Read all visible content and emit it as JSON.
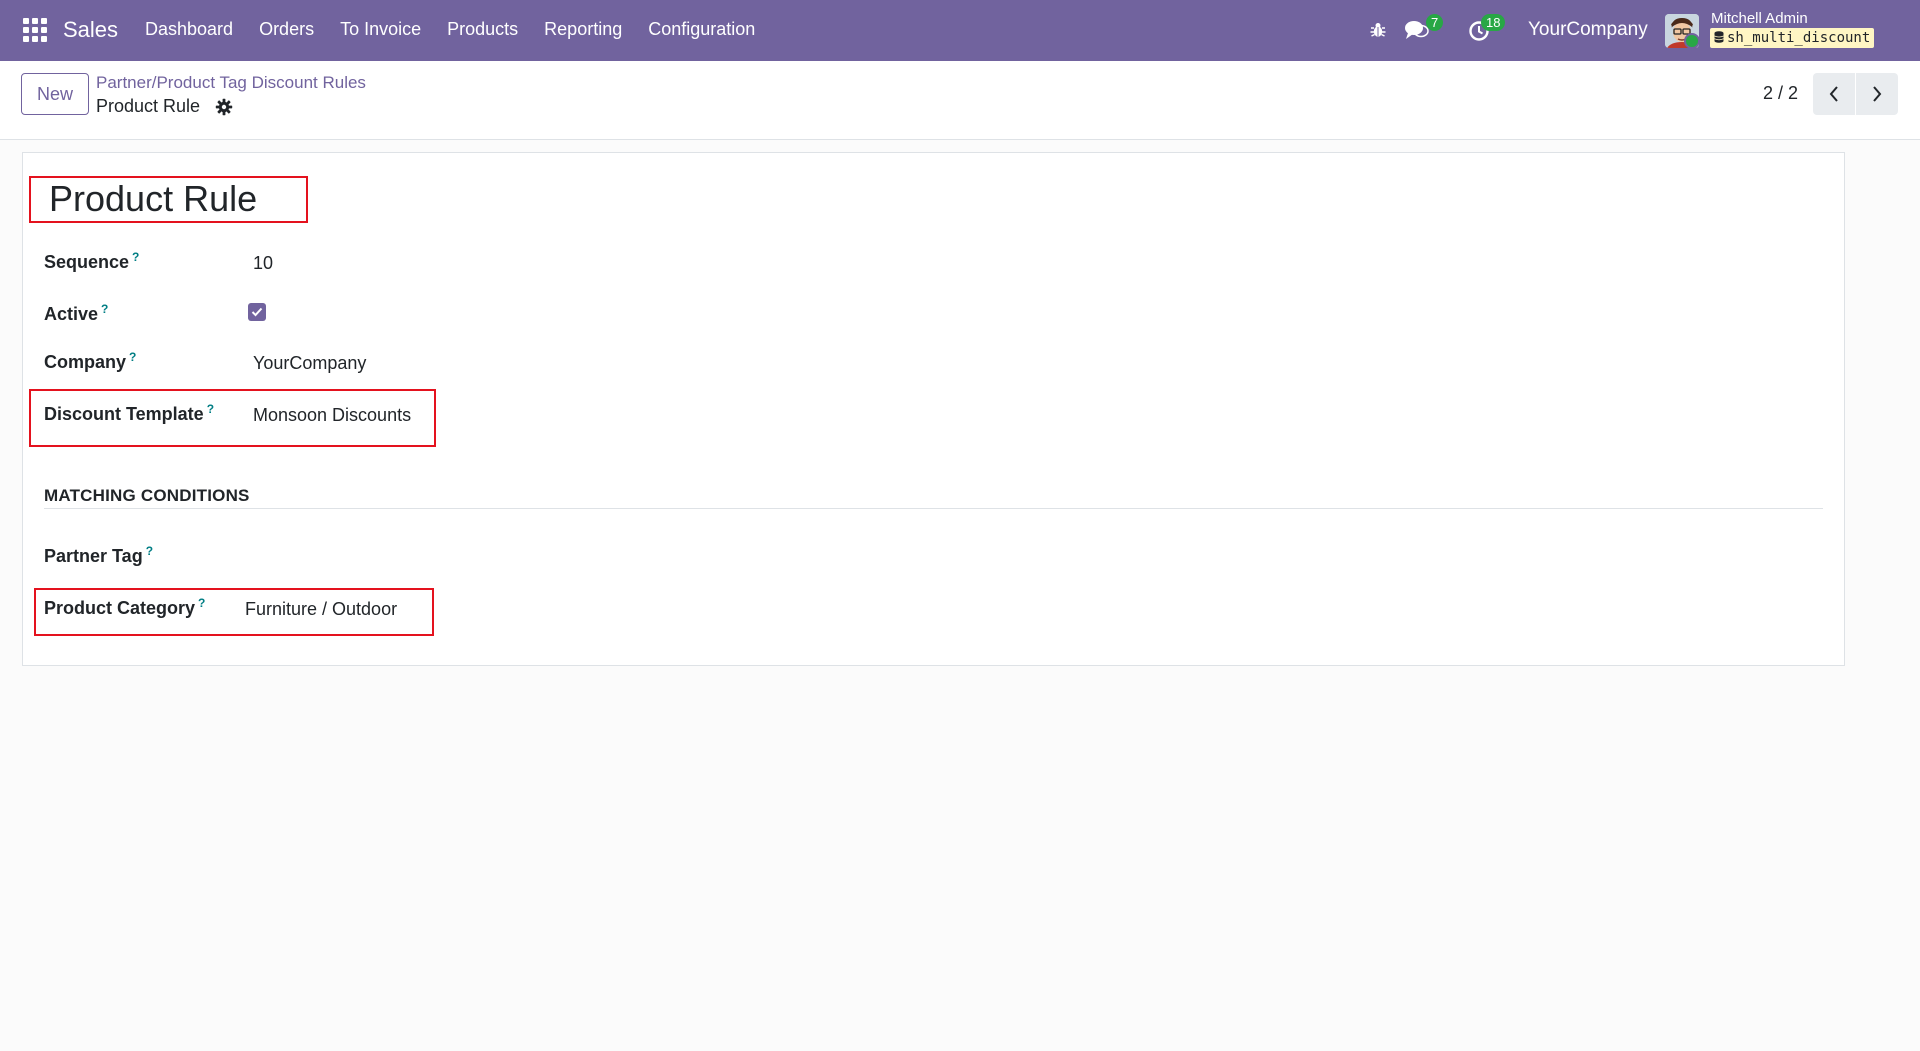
{
  "navbar": {
    "app_name": "Sales",
    "menu": [
      "Dashboard",
      "Orders",
      "To Invoice",
      "Products",
      "Reporting",
      "Configuration"
    ],
    "chat_count": "7",
    "activity_count": "18",
    "company": "YourCompany",
    "user_name": "Mitchell Admin",
    "database": "sh_multi_discount"
  },
  "control_panel": {
    "new_label": "New",
    "breadcrumb_parent": "Partner/Product Tag Discount Rules",
    "breadcrumb_current": "Product Rule",
    "pager": "2 / 2"
  },
  "form": {
    "title": "Product Rule",
    "fields": {
      "sequence": {
        "label": "Sequence",
        "help": "?",
        "value": "10"
      },
      "active": {
        "label": "Active",
        "help": "?",
        "checked": true
      },
      "company": {
        "label": "Company",
        "help": "?",
        "value": "YourCompany"
      },
      "discount_template": {
        "label": "Discount Template",
        "help": "?",
        "value": "Monsoon Discounts"
      }
    },
    "section_title": "MATCHING CONDITIONS",
    "conditions": {
      "partner_tag": {
        "label": "Partner Tag",
        "help": "?",
        "value": ""
      },
      "product_category": {
        "label": "Product Category",
        "help": "?",
        "value": "Furniture / Outdoor"
      }
    }
  },
  "colors": {
    "brand": "#71639e",
    "highlight": "#e4121e",
    "badge": "#28a745",
    "help": "#017e84"
  }
}
